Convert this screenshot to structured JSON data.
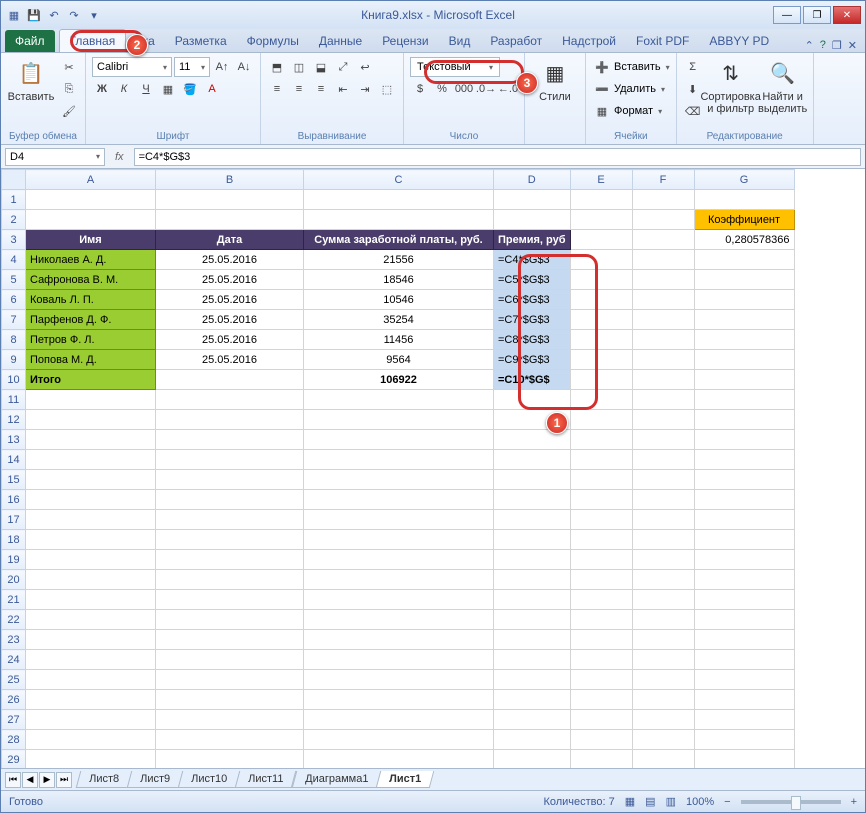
{
  "title": "Книга9.xlsx - Microsoft Excel",
  "tabs": {
    "file": "Файл",
    "home": "Главная",
    "t2_suffix": "вка",
    "layout": "Разметка",
    "formulas": "Формулы",
    "data": "Данные",
    "review": "Рецензи",
    "view": "Вид",
    "dev": "Разработ",
    "addins": "Надстрой",
    "foxit": "Foxit PDF",
    "abbyy": "ABBYY PD"
  },
  "ribbon": {
    "clipboard": {
      "paste": "Вставить",
      "label": "Буфер обмена"
    },
    "font": {
      "name": "Calibri",
      "size": "11",
      "label": "Шрифт"
    },
    "align": {
      "label": "Выравнивание"
    },
    "number": {
      "format": "Текстовый",
      "label": "Число"
    },
    "styles": {
      "label": "Стили"
    },
    "cells": {
      "insert": "Вставить",
      "delete": "Удалить",
      "format": "Формат",
      "label": "Ячейки"
    },
    "editing": {
      "sort": "Сортировка и фильтр",
      "find": "Найти и выделить",
      "label": "Редактирование"
    }
  },
  "namebox": "D4",
  "formula": "=C4*$G$3",
  "cols": [
    "A",
    "B",
    "C",
    "D",
    "E",
    "F",
    "G"
  ],
  "headers": {
    "name": "Имя",
    "date": "Дата",
    "salary": "Сумма заработной платы, руб.",
    "bonus": "Премия, руб"
  },
  "coef": {
    "label": "Коэффициент",
    "value": "0,280578366"
  },
  "rows": [
    {
      "n": "Николаев А. Д.",
      "d": "25.05.2016",
      "s": "21556",
      "f": "=C4*$G$3"
    },
    {
      "n": "Сафронова В. М.",
      "d": "25.05.2016",
      "s": "18546",
      "f": "=C5*$G$3"
    },
    {
      "n": "Коваль Л. П.",
      "d": "25.05.2016",
      "s": "10546",
      "f": "=C6*$G$3"
    },
    {
      "n": "Парфенов Д. Ф.",
      "d": "25.05.2016",
      "s": "35254",
      "f": "=C7*$G$3"
    },
    {
      "n": "Петров Ф. Л.",
      "d": "25.05.2016",
      "s": "11456",
      "f": "=C8*$G$3"
    },
    {
      "n": "Попова М. Д.",
      "d": "25.05.2016",
      "s": "9564",
      "f": "=C9*$G$3"
    }
  ],
  "total": {
    "label": "Итого",
    "sum": "106922",
    "f": "=C10*$G$"
  },
  "sheets": [
    "Лист8",
    "Лист9",
    "Лист10",
    "Лист11",
    "Диаграмма1",
    "Лист1"
  ],
  "status": {
    "ready": "Готово",
    "count": "Количество: 7",
    "zoom": "100%"
  },
  "callouts": {
    "c1": "1",
    "c2": "2",
    "c3": "3"
  }
}
